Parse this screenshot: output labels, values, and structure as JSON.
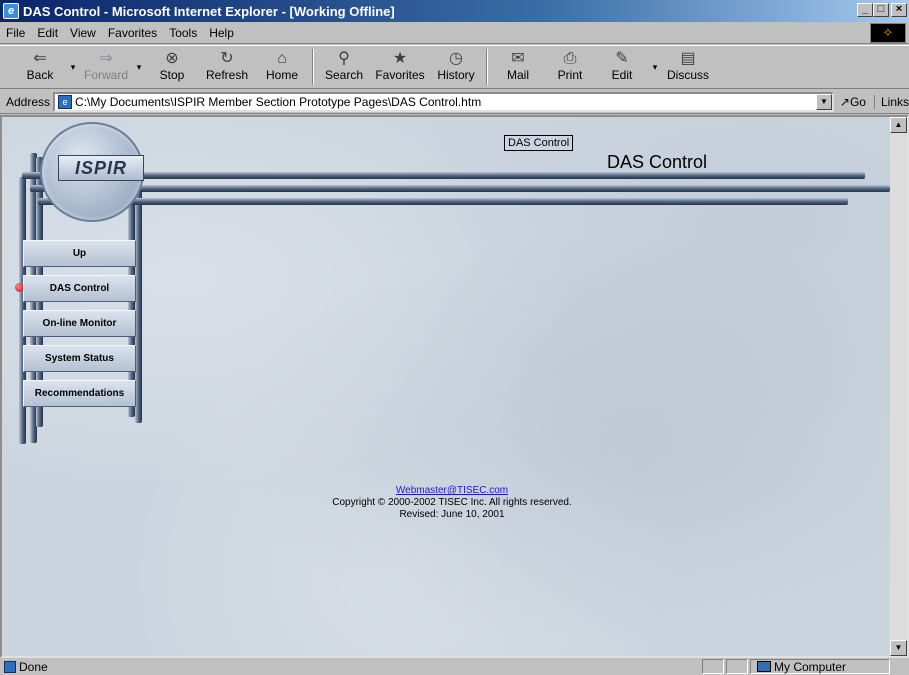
{
  "window": {
    "title": "DAS Control - Microsoft Internet Explorer - [Working Offline]",
    "minimize": "_",
    "restore": "□",
    "close": "×"
  },
  "menu": {
    "items": [
      "File",
      "Edit",
      "View",
      "Favorites",
      "Tools",
      "Help"
    ]
  },
  "toolbar": {
    "back": "Back",
    "forward": "Forward",
    "stop": "Stop",
    "refresh": "Refresh",
    "home": "Home",
    "search": "Search",
    "favorites": "Favorites",
    "history": "History",
    "mail": "Mail",
    "print": "Print",
    "edit": "Edit",
    "discuss": "Discuss"
  },
  "address": {
    "label": "Address",
    "value": "C:\\My Documents\\ISPIR Member Section Prototype Pages\\DAS Control.htm",
    "go": "Go",
    "links": "Links"
  },
  "page": {
    "logo": "ISPIR",
    "label_box": "DAS Control",
    "heading": "DAS Control",
    "nav": [
      "Up",
      "DAS Control",
      "On-line Monitor",
      "System Status",
      "Recommendations"
    ],
    "footer": {
      "email": "Webmaster@TISEC.com",
      "copyright": "Copyright © 2000-2002 TISEC Inc.  All rights reserved.",
      "revised": "Revised: June 10, 2001"
    }
  },
  "status": {
    "text": "Done",
    "zone": "My Computer"
  }
}
